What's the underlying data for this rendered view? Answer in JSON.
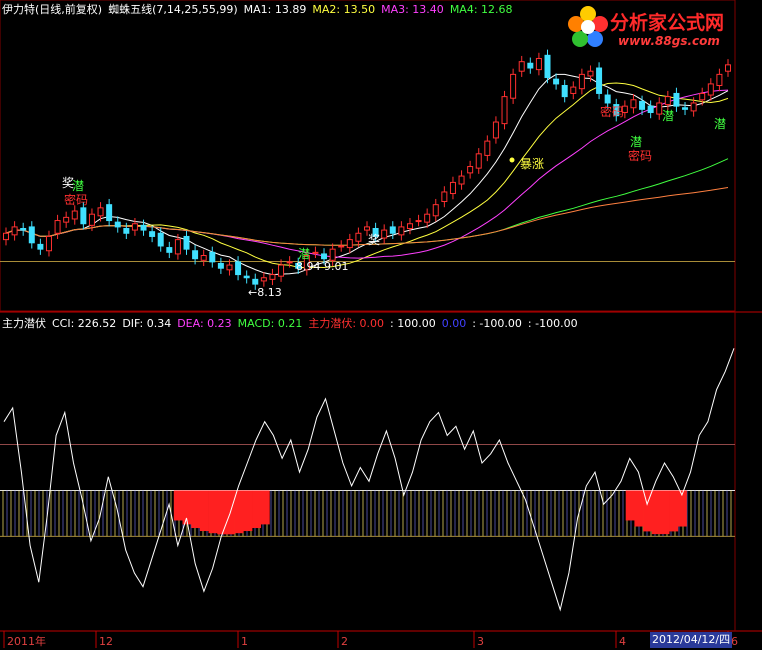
{
  "header_top": {
    "name": "伊力特(日线,前复权)",
    "indicator": "蜘蛛五线(7,14,25,55,99)",
    "ma1": "MA1: 13.89",
    "ma2": "MA2: 13.50",
    "ma3": "MA3: 13.40",
    "ma4": "MA4: 12.68",
    "colors": {
      "name": "#ffffff",
      "ma1": "#ffffff",
      "ma2": "#ffff40",
      "ma3": "#ff40ff",
      "ma4": "#40ff40",
      "arrow": "#ff3030"
    }
  },
  "header_bottom": {
    "name": "主力潜伏",
    "cci": "CCI: 226.52",
    "dif": "DIF: 0.34",
    "dea": "DEA: 0.23",
    "macd": "MACD: 0.21",
    "zlqf": "主力潜伏: 0.00",
    "v1": ": 100.00",
    "v2": "0.00",
    "v3": ": -100.00",
    "v4": ": -100.00"
  },
  "logo": {
    "title": "分析家公式网",
    "url": "www.88gs.com"
  },
  "annotations": {
    "low_label": "←8.13",
    "pivot_label_a": "8.94",
    "pivot_label_b": "9.01",
    "surge": "暴涨",
    "qian": "潜",
    "mima": "密码",
    "jiang": "奖"
  },
  "x_axis": {
    "ticks": [
      "2011年",
      "12",
      "1",
      "2",
      "3",
      "4",
      "6"
    ],
    "cursor_date": "2012/04/12/四"
  },
  "chart_data": [
    {
      "type": "candlestick",
      "description_source": "main price panel with 5 moving averages",
      "y_range": [
        7.8,
        16.8
      ],
      "closes": [
        9.9,
        10.1,
        10.0,
        9.6,
        9.4,
        9.8,
        10.3,
        10.4,
        10.6,
        10.2,
        10.5,
        10.7,
        10.3,
        10.1,
        9.9,
        10.2,
        10.0,
        9.8,
        9.5,
        9.3,
        9.7,
        9.4,
        9.1,
        9.2,
        9.0,
        8.8,
        8.9,
        8.6,
        8.5,
        8.3,
        8.5,
        8.6,
        8.9,
        9.0,
        8.8,
        9.2,
        9.3,
        9.1,
        9.4,
        9.5,
        9.7,
        9.9,
        10.1,
        9.8,
        10.0,
        9.9,
        10.1,
        10.2,
        10.3,
        10.5,
        10.8,
        11.2,
        11.5,
        11.7,
        12.0,
        12.4,
        12.8,
        13.4,
        14.2,
        14.9,
        15.3,
        15.1,
        15.4,
        14.8,
        14.6,
        14.2,
        14.5,
        14.9,
        15.0,
        14.3,
        14.0,
        13.6,
        13.9,
        14.1,
        13.8,
        13.7,
        14.0,
        14.2,
        13.9,
        13.8,
        14.0,
        14.3,
        14.6,
        14.9,
        15.2
      ],
      "ma_series": [
        {
          "name": "MA1",
          "color": "#ffffff"
        },
        {
          "name": "MA2",
          "color": "#ffff40"
        },
        {
          "name": "MA3",
          "color": "#ff40ff"
        },
        {
          "name": "MA4",
          "color": "#40ff40"
        },
        {
          "name": "MA5",
          "color": "#ff8040"
        }
      ]
    },
    {
      "type": "line",
      "description_source": "CCI indicator panel",
      "y_range": [
        -300,
        350
      ],
      "reference_levels": [
        100,
        -100
      ],
      "cci": [
        150,
        180,
        40,
        -120,
        -200,
        -50,
        120,
        170,
        60,
        -20,
        -110,
        -60,
        30,
        -40,
        -130,
        -180,
        -210,
        -150,
        -90,
        -30,
        -120,
        -60,
        -160,
        -220,
        -170,
        -100,
        -50,
        10,
        60,
        110,
        150,
        120,
        70,
        110,
        40,
        90,
        160,
        200,
        130,
        60,
        10,
        50,
        20,
        80,
        130,
        70,
        -10,
        40,
        110,
        150,
        170,
        120,
        140,
        90,
        130,
        60,
        80,
        110,
        60,
        20,
        -20,
        -80,
        -140,
        -200,
        -260,
        -180,
        -60,
        10,
        40,
        -30,
        -10,
        20,
        70,
        40,
        -30,
        20,
        60,
        30,
        -10,
        40,
        120,
        150,
        220,
        260,
        310
      ]
    }
  ]
}
